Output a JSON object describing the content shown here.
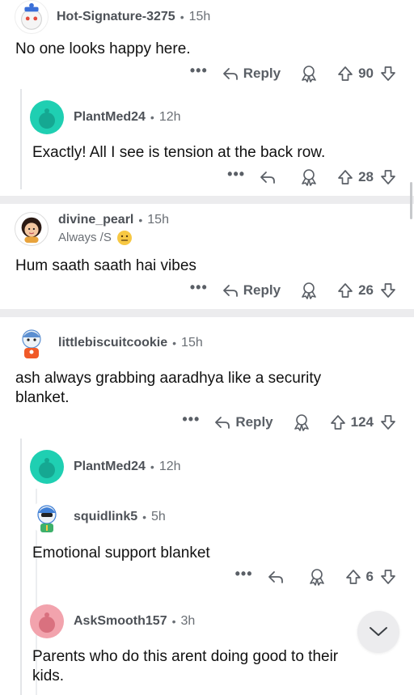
{
  "comments": [
    {
      "user": "Hot-Signature-3275",
      "time": "15h",
      "text": "No one looks happy here.",
      "reply_label": "Reply",
      "votes": "90"
    },
    {
      "user": "PlantMed24",
      "time": "12h",
      "text": "Exactly! All I see is tension at the back row.",
      "votes": "28"
    },
    {
      "user": "divine_pearl",
      "time": "15h",
      "flair": "Always /S",
      "text": "Hum saath saath hai vibes",
      "reply_label": "Reply",
      "votes": "26"
    },
    {
      "user": "littlebiscuitcookie",
      "time": "15h",
      "text": "ash always grabbing aaradhya like a security blanket.",
      "reply_label": "Reply",
      "votes": "124"
    },
    {
      "user": "PlantMed24",
      "time": "12h"
    },
    {
      "user": "squidlink5",
      "time": "5h",
      "text": "Emotional support blanket",
      "votes": "6"
    },
    {
      "user": "AskSmooth157",
      "time": "3h",
      "text": "Parents who do this arent doing good to their kids."
    }
  ],
  "more_label": "•••",
  "dot": "•",
  "colors": {
    "avatar_teal": "#1fcfb2",
    "avatar_pink": "#f2a3ad",
    "separator": "#ececee",
    "thread_line": "#e3e5e8"
  },
  "icons": [
    "reply-arrow-icon",
    "award-icon",
    "upvote-icon",
    "downvote-icon",
    "chevron-down-icon",
    "snoo-icon",
    "emoji-icon"
  ]
}
